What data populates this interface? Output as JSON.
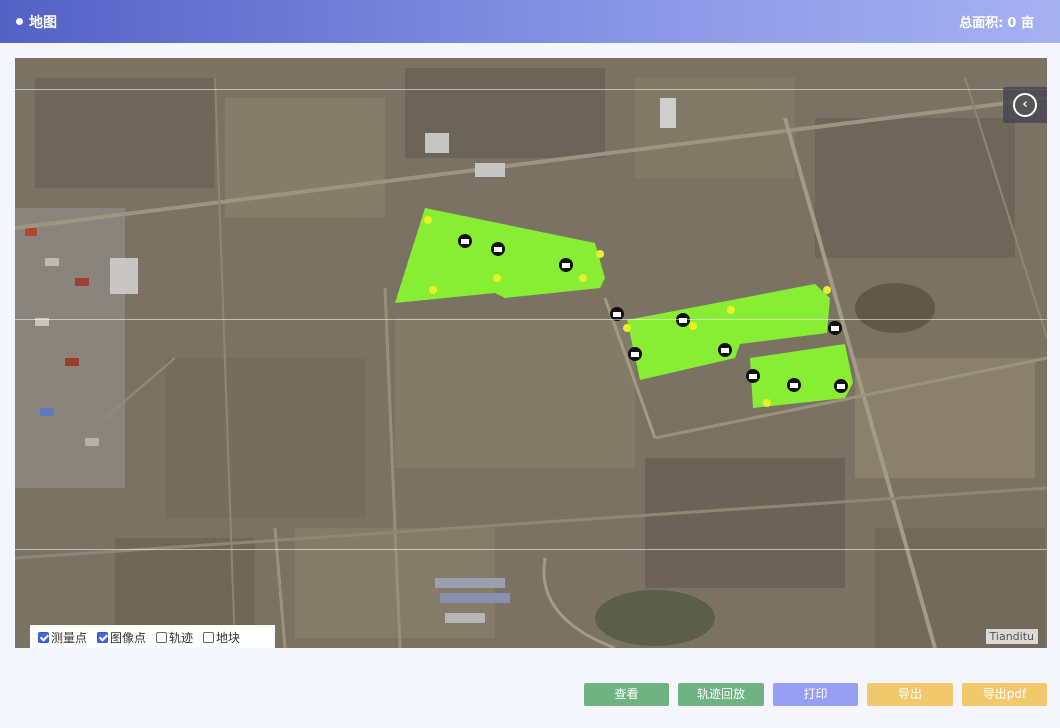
{
  "header": {
    "title": "地图",
    "area_label": "总面积:",
    "area_value": "0 亩"
  },
  "map": {
    "attribution": "Tianditu",
    "layers": [
      {
        "label": "测量点",
        "checked": true
      },
      {
        "label": "图像点",
        "checked": true
      },
      {
        "label": "轨迹",
        "checked": false
      },
      {
        "label": "地块",
        "checked": false
      }
    ],
    "colors": {
      "field_fill": "#88ee33",
      "point_yellow": "#e8f028",
      "camera_marker": "#111111"
    }
  },
  "buttons": {
    "view": {
      "label": "查看",
      "color": "#6fb383"
    },
    "replay": {
      "label": "轨迹回放",
      "color": "#6fb383"
    },
    "print": {
      "label": "打印",
      "color": "#979ff5"
    },
    "export": {
      "label": "导出",
      "color": "#f1c86b"
    },
    "export_pdf": {
      "label": "导出pdf",
      "color": "#f1c86b"
    }
  }
}
